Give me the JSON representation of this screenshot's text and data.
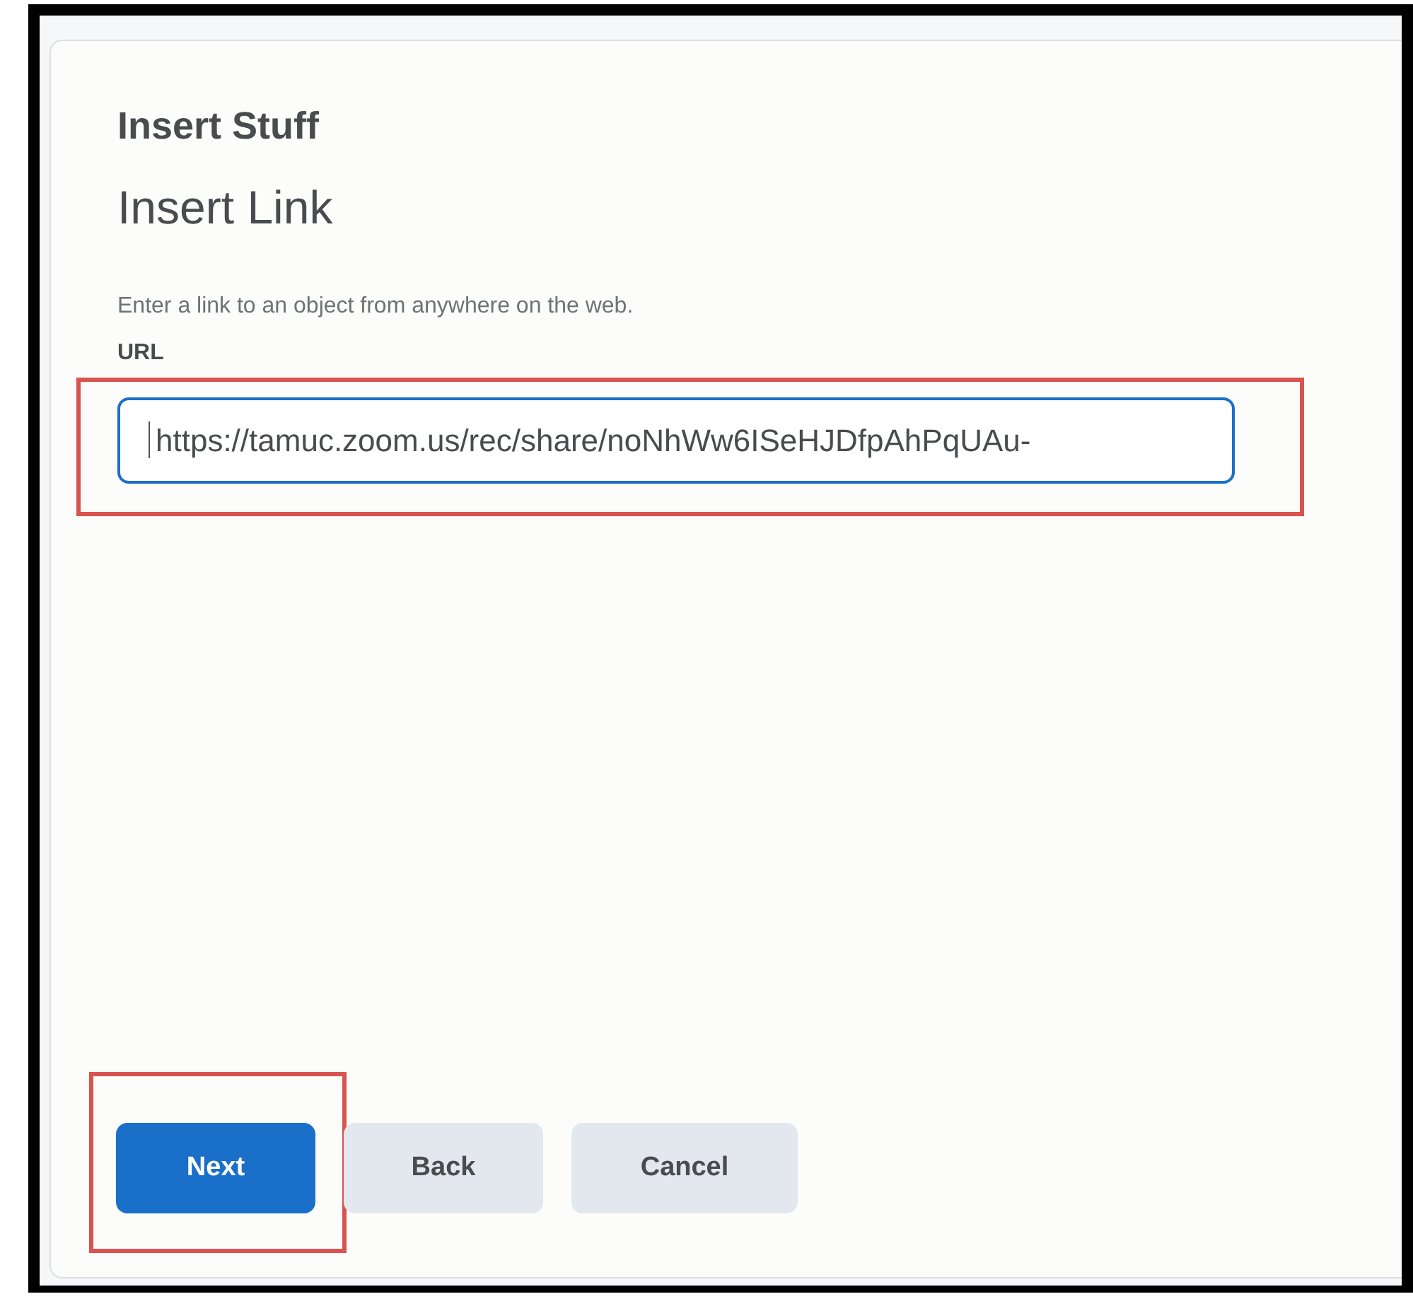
{
  "dialog": {
    "title": "Insert Stuff",
    "heading": "Insert Link",
    "description": "Enter a link to an object from anywhere on the web.",
    "url_field": {
      "label": "URL",
      "value": "https://tamuc.zoom.us/rec/share/noNhWw6ISeHJDfpAhPqUAu-",
      "focused": true,
      "highlighted": true
    },
    "buttons": [
      {
        "label": "Next",
        "kind": "primary",
        "highlighted": true
      },
      {
        "label": "Back",
        "kind": "secondary",
        "highlighted": false
      },
      {
        "label": "Cancel",
        "kind": "secondary",
        "highlighted": false
      }
    ]
  }
}
